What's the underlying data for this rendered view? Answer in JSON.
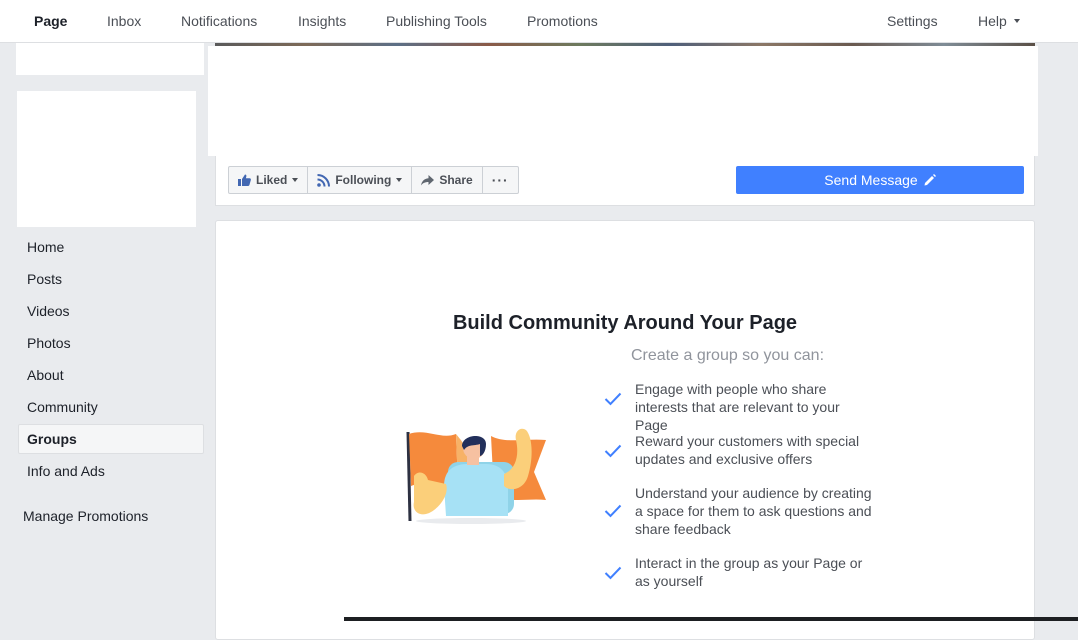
{
  "topnav": {
    "items": [
      {
        "label": "Page",
        "active": true
      },
      {
        "label": "Inbox"
      },
      {
        "label": "Notifications"
      },
      {
        "label": "Insights"
      },
      {
        "label": "Publishing Tools"
      },
      {
        "label": "Promotions"
      }
    ],
    "settings": "Settings",
    "help": "Help"
  },
  "sidebar": {
    "items": [
      {
        "label": "Home"
      },
      {
        "label": "Posts"
      },
      {
        "label": "Videos"
      },
      {
        "label": "Photos"
      },
      {
        "label": "About"
      },
      {
        "label": "Community"
      },
      {
        "label": "Groups",
        "selected": true
      },
      {
        "label": "Info and Ads"
      }
    ],
    "manage": "Manage Promotions"
  },
  "actions": {
    "liked": "Liked",
    "following": "Following",
    "share": "Share",
    "more": "···",
    "send_message": "Send Message"
  },
  "community": {
    "title": "Build Community Around Your Page",
    "subtitle": "Create a group so you can:",
    "benefits": [
      "Engage with people who share interests that are relevant to your Page",
      "Reward your customers with special updates and exclusive offers",
      "Understand your audience by creating a space for them to ask questions and share feedback",
      "Interact in the group as your Page or as yourself"
    ]
  },
  "colors": {
    "accent": "#4080ff",
    "check": "#4080ff",
    "flag": "#f58a3c"
  }
}
